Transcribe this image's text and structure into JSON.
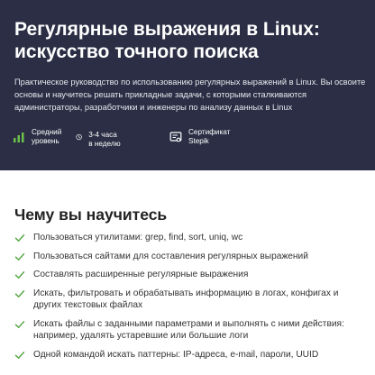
{
  "hero": {
    "title": "Регулярные выражения в Linux: искусство точного поиска",
    "description": "Практическое руководство по использованию регулярных выражений в Linux. Вы освоите основы и научитесь решать прикладные задачи, с которыми сталкиваются администраторы, разработчики и инженеры по анализу данных в Linux",
    "background_color": "#2b2e44",
    "meta": [
      {
        "icon": "level-bars-icon",
        "line1": "Средний",
        "line2": "уровень"
      },
      {
        "icon": "clock-icon",
        "line1": "3-4 часа в неделю",
        "line2": ""
      },
      {
        "icon": "certificate-icon",
        "line1": "Сертификат",
        "line2": "Stepik"
      }
    ]
  },
  "learn": {
    "title": "Чему вы научитесь",
    "check_color": "#5aa84b",
    "items": [
      "Пользоваться утилитами: grep, find, sort, uniq, wc",
      "Пользоваться сайтами для составления регулярных выражений",
      "Составлять расширенные регулярные выражения",
      "Искать, фильтровать и обрабатывать информацию в логах, конфигах и других текстовых файлах",
      "Искать файлы с заданными параметрами и выполнять с ними действия: например, удалять устаревшие или большие логи",
      "Одной командой искать паттерны: IP-адреса, e-mail, пароли, UUID"
    ]
  }
}
